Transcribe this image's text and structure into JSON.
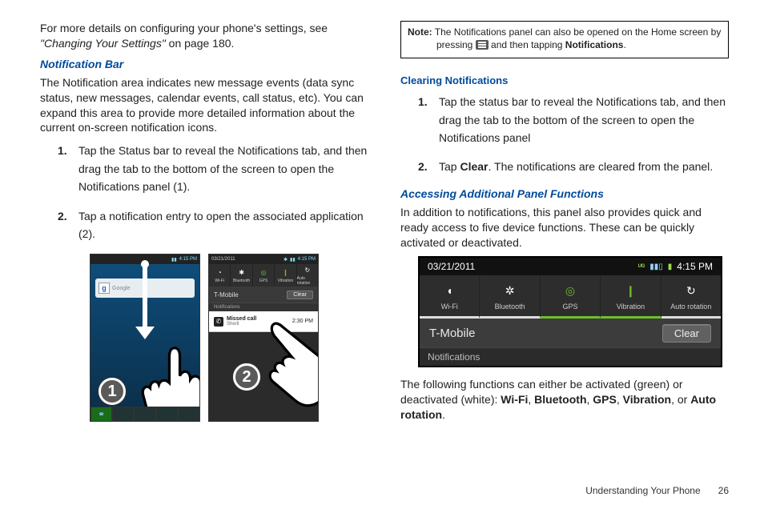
{
  "col1": {
    "intro1": "For more details on configuring your phone's settings, see ",
    "intro_ref": "\"Changing Your Settings\"",
    "intro2": " on page 180.",
    "h_notifbar": "Notification Bar",
    "p_notifbar": "The Notification area indicates new message events (data sync status, new messages, calendar events, call status, etc). You can expand this area to provide more detailed information about the current on-screen notification icons.",
    "li1": "Tap the Status bar to reveal the Notifications tab, and then drag the tab to the bottom of the screen to open the Notifications panel (1).",
    "li2": "Tap a notification entry to open the associated application (2).",
    "phone1": {
      "time": "4:15 PM",
      "search": "Google",
      "circle": "1"
    },
    "phone2": {
      "date": "03/21/2011",
      "time": "4:15 PM",
      "qs": [
        "Wi-Fi",
        "Bluetooth",
        "GPS",
        "Vibration",
        "Auto rotation"
      ],
      "carrier": "T-Mobile",
      "clear": "Clear",
      "notif_head": "Notifications",
      "missed": "Missed call",
      "missed_sub": "Sheril",
      "missed_time": "2:30 PM",
      "circle": "2"
    }
  },
  "col2": {
    "note_label": "Note:",
    "note1": " The Notifications panel can also be opened on the Home screen by ",
    "note2a": "pressing ",
    "note2b": " and then tapping ",
    "note_bold": "Notifications",
    "h_clearing": "Clearing Notifications",
    "li1": "Tap the status bar to reveal the Notifications tab, and then drag the tab to the bottom of the screen to open the Notifications panel",
    "li2a": "Tap ",
    "li2b": "Clear",
    "li2c": ". The notifications are cleared from the panel.",
    "h_access": "Accessing Additional Panel Functions",
    "p_access": "In addition to notifications, this panel also provides quick and ready access to five device functions. These can be quickly activated or deactivated.",
    "panel": {
      "date": "03/21/2011",
      "time": "4:15 PM",
      "qs": [
        {
          "label": "Wi-Fi",
          "glyph": "◖",
          "cls": "underline-white"
        },
        {
          "label": "Bluetooth",
          "glyph": "✲",
          "cls": "underline-white"
        },
        {
          "label": "GPS",
          "glyph": "◎",
          "cls": "underline-green"
        },
        {
          "label": "Vibration",
          "glyph": "❙",
          "cls": "underline-green"
        },
        {
          "label": "Auto rotation",
          "glyph": "↻",
          "cls": "underline-white"
        }
      ],
      "carrier": "T-Mobile",
      "clear": "Clear",
      "notif_head": "Notifications"
    },
    "p_follow1": "The following functions can either be activated (green) or deactivated (white): ",
    "fns": [
      "Wi-Fi",
      "Bluetooth",
      "GPS",
      "Vibration",
      "Auto rotation"
    ],
    "or": ", or ",
    "sep": ", ",
    "period": "."
  },
  "footer": {
    "section": "Understanding Your Phone",
    "page": "26"
  }
}
